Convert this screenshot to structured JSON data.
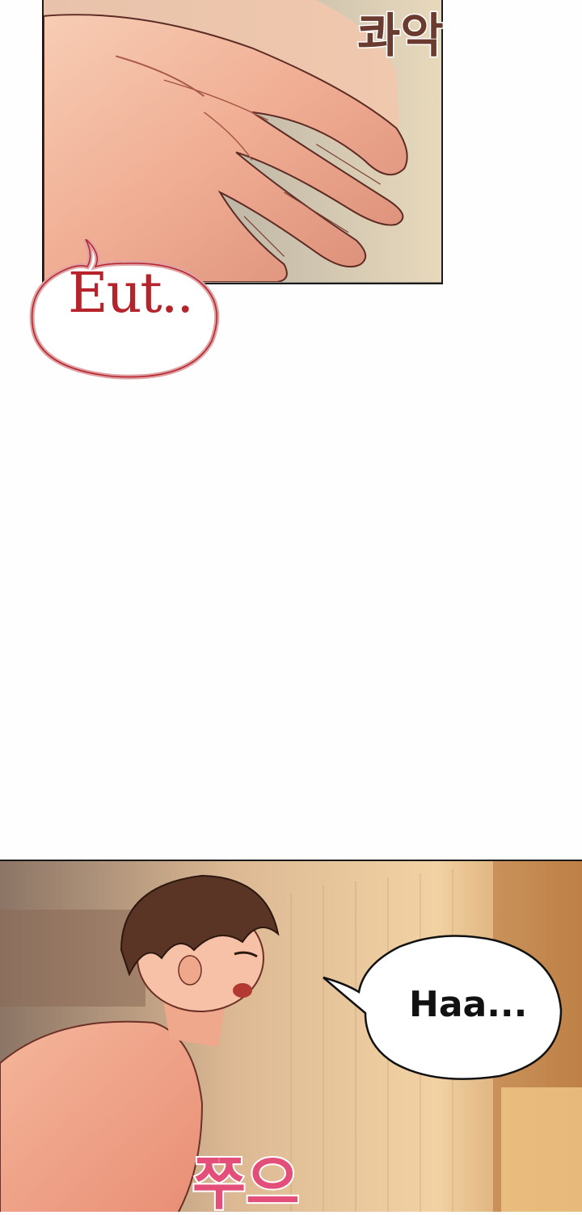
{
  "panels": {
    "top": {
      "sfx_text": "콰악",
      "speech_text": "Eut.."
    },
    "bottom": {
      "speech_text": "Haa...",
      "sfx_text": "쭈으"
    }
  },
  "colors": {
    "page_background": "#fefefe",
    "panel_border": "#1a1a1a",
    "speech_red": "#b5242a",
    "sfx_red": "#e44f7a",
    "sfx_brown": "#6b3b2f",
    "skin": "#f2b59d",
    "hair": "#5a3526"
  },
  "icons": {
    "speech_bubble_red": "speech-bubble-icon",
    "speech_bubble_black": "speech-bubble-icon"
  }
}
